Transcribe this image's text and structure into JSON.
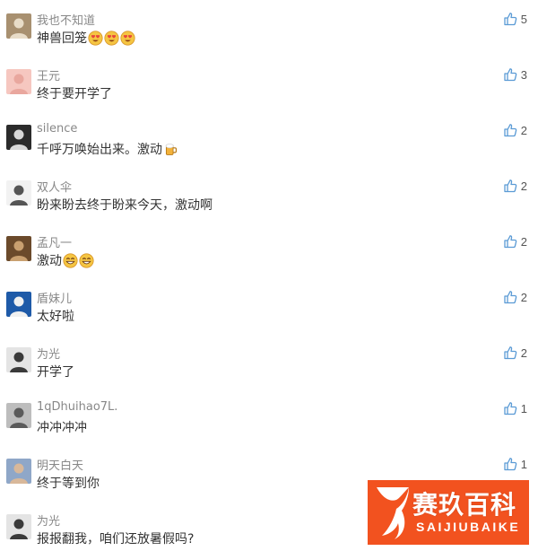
{
  "comments": [
    {
      "user": "我也不知道",
      "text": "神兽回笼",
      "emojis": [
        "heart-eyes",
        "heart-eyes",
        "heart-eyes"
      ],
      "likes": "5",
      "avatar": {
        "icon": "cat-avatar-icon",
        "bg": "#a89070",
        "fg": "#e8dcc8"
      }
    },
    {
      "user": "王元",
      "text": "终于要开学了",
      "emojis": [],
      "likes": "3",
      "avatar": {
        "icon": "pink-avatar-icon",
        "bg": "#f6c7c0",
        "fg": "#e9a79e"
      }
    },
    {
      "user": "silence",
      "text": "千呼万唤始出来。激动",
      "emojis": [
        "beer"
      ],
      "likes": "2",
      "avatar": {
        "icon": "face-avatar-icon",
        "bg": "#2b2b2b",
        "fg": "#d8d8d8"
      }
    },
    {
      "user": "双人伞",
      "text": "盼来盼去终于盼来今天，激动啊",
      "emojis": [],
      "likes": "2",
      "avatar": {
        "icon": "umbrella-avatar-icon",
        "bg": "#f2f2f2",
        "fg": "#555555"
      }
    },
    {
      "user": "孟凡一",
      "text": "激动",
      "emojis": [
        "grin",
        "grin"
      ],
      "likes": "2",
      "avatar": {
        "icon": "photo-avatar-icon",
        "bg": "#6b4a2b",
        "fg": "#c9a070"
      }
    },
    {
      "user": "盾妹儿",
      "text": "太好啦",
      "emojis": [],
      "likes": "2",
      "avatar": {
        "icon": "pool-avatar-icon",
        "bg": "#1e5aa8",
        "fg": "#f0f0f0"
      }
    },
    {
      "user": "为光",
      "text": "开学了",
      "emojis": [],
      "likes": "2",
      "avatar": {
        "icon": "silhouette-avatar-icon",
        "bg": "#e4e4e4",
        "fg": "#3a3a3a"
      }
    },
    {
      "user": "1qDhuihao7L.",
      "text": "冲冲冲冲",
      "emojis": [],
      "likes": "1",
      "avatar": {
        "icon": "bw-face-avatar-icon",
        "bg": "#bdbdbd",
        "fg": "#5a5a5a"
      }
    },
    {
      "user": "明天白天",
      "text": "终于等到你",
      "emojis": [],
      "likes": "1",
      "avatar": {
        "icon": "portrait-avatar-icon",
        "bg": "#8fa7c8",
        "fg": "#d8b89a"
      }
    },
    {
      "user": "为光",
      "text": "报报翻我，咱们还放暑假吗?",
      "emojis": [],
      "likes": "",
      "avatar": {
        "icon": "silhouette-avatar-icon",
        "bg": "#e4e4e4",
        "fg": "#3a3a3a"
      }
    }
  ],
  "watermark": {
    "title": "赛玖百科",
    "subtitle": "SAIJIUBAIKE",
    "color": "#f2521f"
  },
  "colors": {
    "like_icon": "#5b9bd5",
    "username": "#888888",
    "text": "#333333"
  }
}
